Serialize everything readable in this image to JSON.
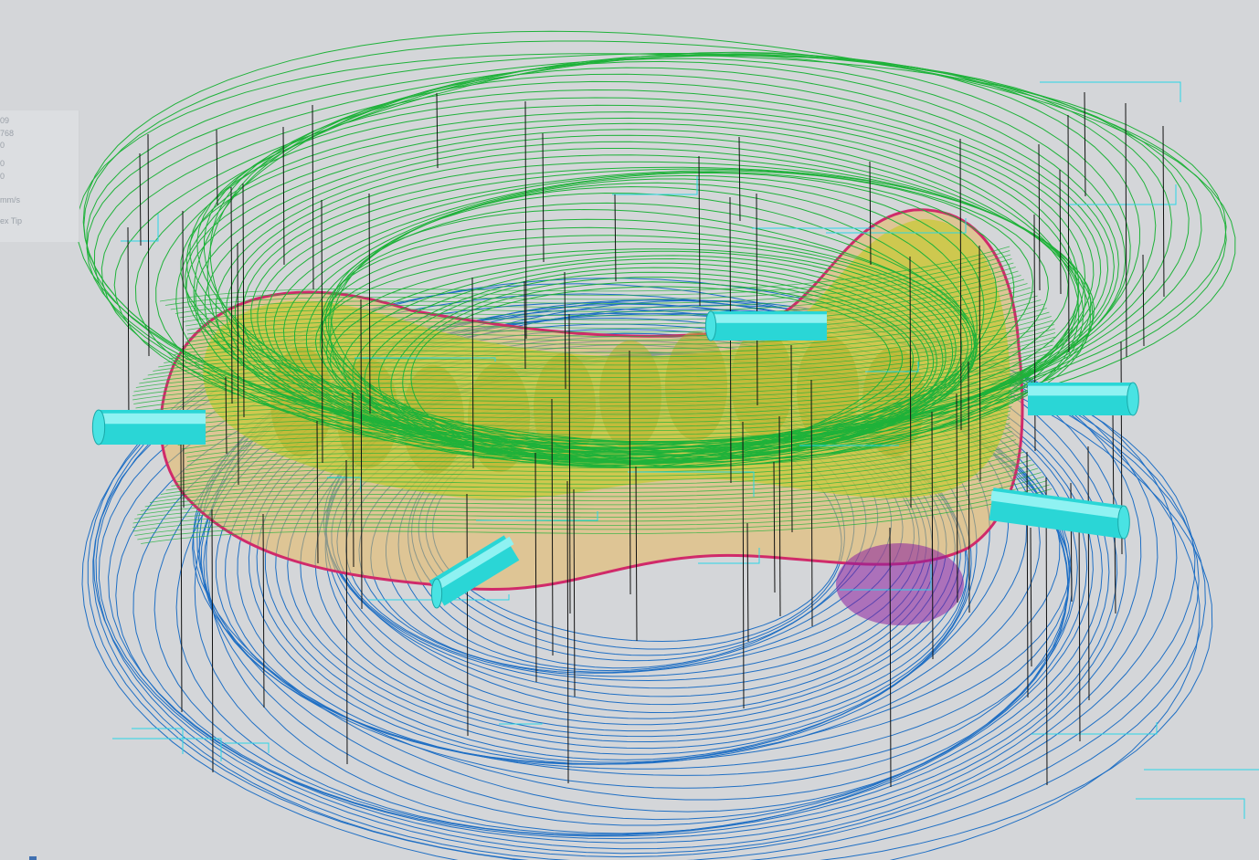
{
  "window": {
    "title": ""
  },
  "info_panel": {
    "lines": [
      "09",
      "768",
      "0",
      "0",
      "0",
      "mm/s",
      "ex Tip"
    ]
  },
  "scene": {
    "background": "#d4d6d9",
    "colors": {
      "upper_paths": "#1fb23a",
      "lower_paths": "#1f6fc4",
      "model_fill": "#c8c838",
      "model_inner": "#e6b85c",
      "model_edge": "#d02a6a",
      "rapid_moves": "#2ad6e6",
      "plunge_lines": "#111111",
      "support_pins": "#2ad6d6",
      "undercut": "#8a1fa0"
    },
    "icons": [
      "toolpath-view",
      "support-pin-icon"
    ]
  }
}
